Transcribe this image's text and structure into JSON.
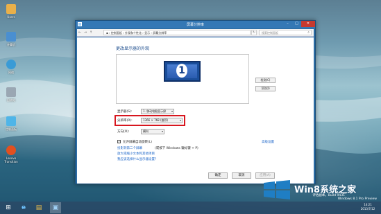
{
  "desktop": {
    "icons": [
      {
        "label": "Users",
        "color": "#e9b04a"
      },
      {
        "label": "计算机",
        "color": "#4a8fd1"
      },
      {
        "label": "网络",
        "color": "#3a9bd6"
      },
      {
        "label": "回收站",
        "color": "#9aa7b3"
      },
      {
        "label": "控制面板",
        "color": "#4fb5e8"
      },
      {
        "label": "Lenovo Transition",
        "color": "#e2501f"
      }
    ]
  },
  "window": {
    "title": "屏幕分辨率",
    "controls": {
      "minimize": "–",
      "maximize": "□",
      "close": "✕"
    },
    "address": {
      "back": "←",
      "forward": "→",
      "up": "↑",
      "breadcrumb": "▪ › 控制面板 › 外观和个性化 › 显示 › 屏幕分辨率",
      "refresh": "↻",
      "search_placeholder": "搜索控制面板"
    },
    "heading": "更改显示器的外观",
    "monitor_number": "1",
    "detect_button": "检测(C)",
    "identify_button": "识别(I)",
    "display_label": "显示器(S):",
    "display_value": "1. 移动电脑显示屏",
    "resolution_label": "分辨率(R):",
    "resolution_value": "1366 × 768 (推荐)",
    "orientation_label": "方向(O):",
    "orientation_value": "横向",
    "allow_rotation_label": "允许屏幕自动旋转(L)",
    "allow_rotation_checked": true,
    "advanced_link": "高级设置",
    "project_link": "投影到第二个屏幕",
    "project_hint": "(或按下 Windows 徽标键 + P)",
    "text_size_link": "放大或缩小文本和其他项目",
    "which_settings_link": "我应该选择什么显示器设置？",
    "ok_button": "确定",
    "cancel_button": "取消",
    "apply_button": "应用(A)"
  },
  "taskbar": {
    "start": "⊞",
    "ie": "e",
    "explorer": "▤",
    "active": "▣",
    "time": "14:21",
    "date": "2013/7/12"
  },
  "watermark": {
    "logo_text": "Win8系统之家",
    "eval_line": "评估副本。Build 9431",
    "edition_line": "Windows 8.1 Pro Preview"
  }
}
